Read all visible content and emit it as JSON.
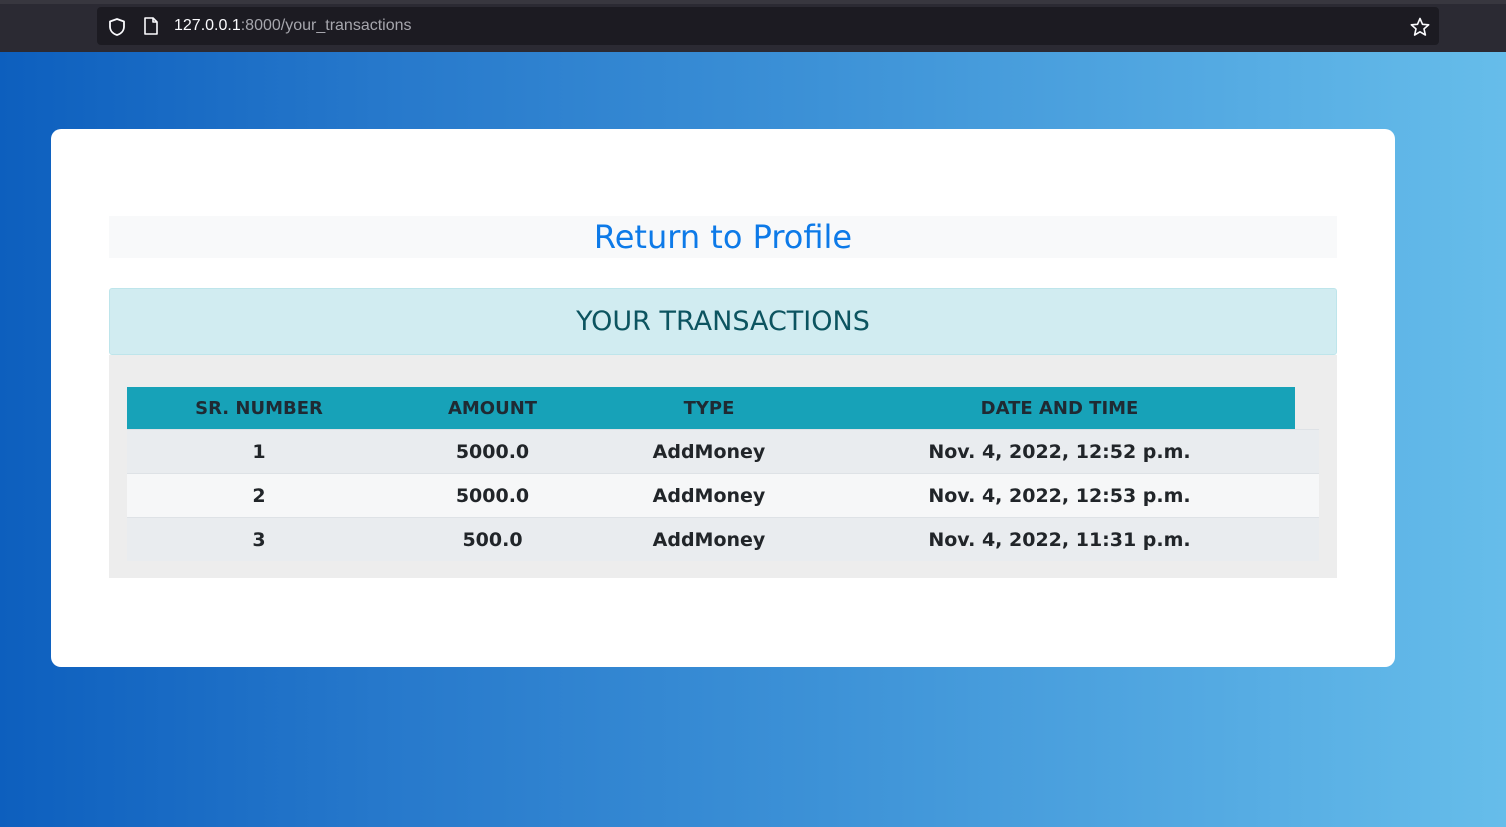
{
  "browser": {
    "url_host": "127.0.0.1",
    "url_rest": ":8000/your_transactions"
  },
  "page": {
    "return_link": "Return to Profile",
    "title": "YOUR TRANSACTIONS"
  },
  "table": {
    "headers": [
      "SR. NUMBER",
      "AMOUNT",
      "TYPE",
      "DATE AND TIME"
    ],
    "rows": [
      [
        "1",
        "5000.0",
        "AddMoney",
        "Nov. 4, 2022, 12:52 p.m."
      ],
      [
        "2",
        "5000.0",
        "AddMoney",
        "Nov. 4, 2022, 12:53 p.m."
      ],
      [
        "3",
        "500.0",
        "AddMoney",
        "Nov. 4, 2022, 11:31 p.m."
      ]
    ]
  },
  "colors": {
    "accent": "#17a2b8",
    "link": "#0d7ae8",
    "alert_bg": "#d1ecf1",
    "alert_text": "#0c5460"
  },
  "icons": {
    "site_info": "shield-icon",
    "page": "page-icon",
    "bookmark": "star-icon"
  }
}
